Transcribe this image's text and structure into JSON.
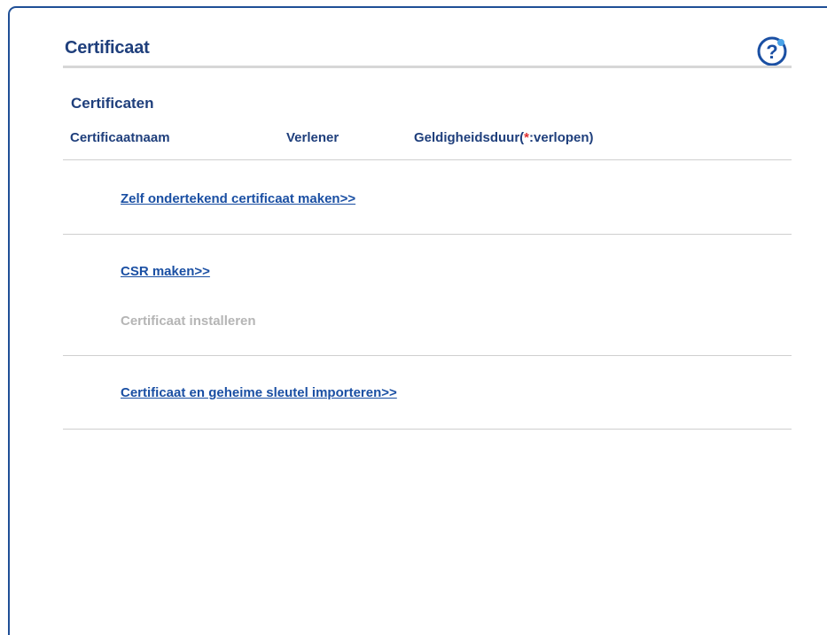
{
  "page": {
    "title": "Certificaat",
    "help_icon": "help-question-icon"
  },
  "certificates": {
    "section_title": "Certificaten",
    "columns": {
      "name": "Certificaatnaam",
      "issuer": "Verlener",
      "validity_prefix": "Geldigheidsduur(",
      "validity_star": "*",
      "validity_suffix": ":verlopen)"
    }
  },
  "actions": {
    "create_self_signed": "Zelf ondertekend certificaat maken>>",
    "create_csr": "CSR maken>>",
    "install_certificate": "Certificaat installeren",
    "import_certificate_key": "Certificaat en geheime sleutel importeren>>"
  },
  "colors": {
    "frame_border": "#1f4f96",
    "heading": "#1f3f7c",
    "link": "#1a4fa3",
    "disabled": "#b5b5b5",
    "required_star": "#e03030"
  }
}
